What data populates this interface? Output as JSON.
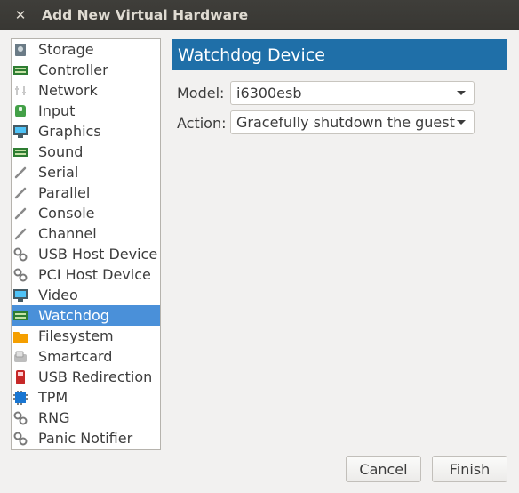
{
  "window": {
    "title": "Add New Virtual Hardware",
    "close_glyph": "✕"
  },
  "sidebar": {
    "selected_index": 13,
    "items": [
      {
        "label": "Storage",
        "icon": "storage-icon"
      },
      {
        "label": "Controller",
        "icon": "controller-icon"
      },
      {
        "label": "Network",
        "icon": "network-icon"
      },
      {
        "label": "Input",
        "icon": "input-icon"
      },
      {
        "label": "Graphics",
        "icon": "graphics-icon"
      },
      {
        "label": "Sound",
        "icon": "sound-icon"
      },
      {
        "label": "Serial",
        "icon": "serial-icon"
      },
      {
        "label": "Parallel",
        "icon": "parallel-icon"
      },
      {
        "label": "Console",
        "icon": "console-icon"
      },
      {
        "label": "Channel",
        "icon": "channel-icon"
      },
      {
        "label": "USB Host Device",
        "icon": "usb-host-icon"
      },
      {
        "label": "PCI Host Device",
        "icon": "pci-host-icon"
      },
      {
        "label": "Video",
        "icon": "video-icon"
      },
      {
        "label": "Watchdog",
        "icon": "watchdog-icon"
      },
      {
        "label": "Filesystem",
        "icon": "filesystem-icon"
      },
      {
        "label": "Smartcard",
        "icon": "smartcard-icon"
      },
      {
        "label": "USB Redirection",
        "icon": "usb-redirection-icon"
      },
      {
        "label": "TPM",
        "icon": "tpm-icon"
      },
      {
        "label": "RNG",
        "icon": "rng-icon"
      },
      {
        "label": "Panic Notifier",
        "icon": "panic-notifier-icon"
      }
    ]
  },
  "main": {
    "header": "Watchdog Device",
    "model_label": "Model:",
    "model_value": "i6300esb",
    "action_label": "Action:",
    "action_value": "Gracefully shutdown the guest"
  },
  "buttons": {
    "cancel": "Cancel",
    "finish": "Finish"
  },
  "colors": {
    "titlebar": "#3c3b37",
    "header_bar": "#1f6fa8",
    "selection": "#4a90d9"
  }
}
